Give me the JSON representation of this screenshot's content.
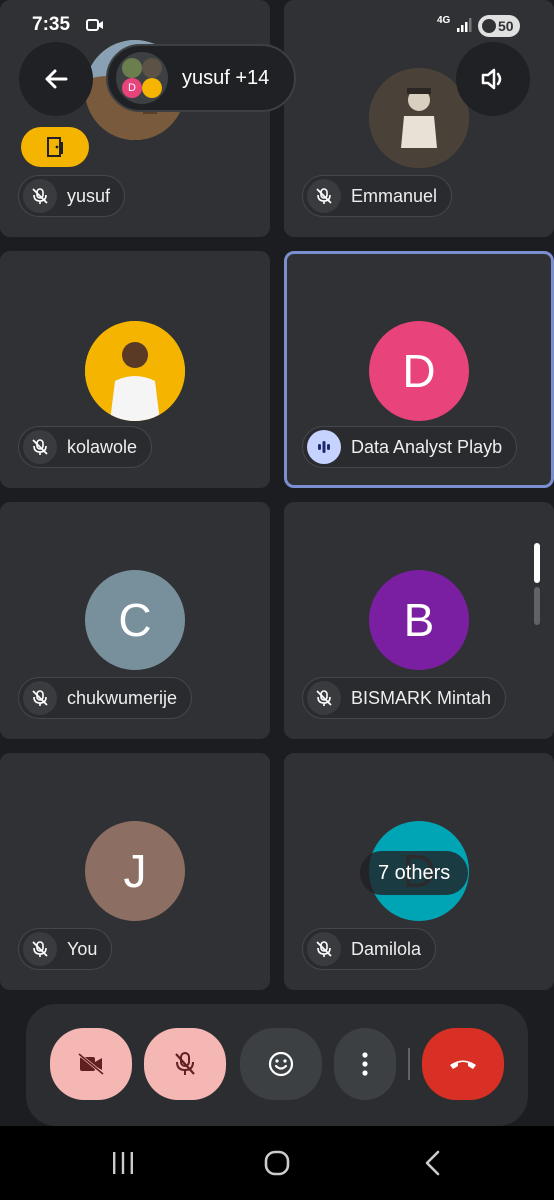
{
  "status": {
    "time": "7:35",
    "network": "4G",
    "battery": "50"
  },
  "header": {
    "participants_label": "yusuf +14"
  },
  "tiles": [
    {
      "name": "yusuf",
      "avatar_letter": "",
      "avatar_color": "#8a7a5a",
      "muted": true
    },
    {
      "name": "Emmanuel",
      "avatar_letter": "",
      "avatar_color": "#6b5e4e",
      "muted": true
    },
    {
      "name": "kolawole",
      "avatar_letter": "",
      "avatar_color": "#f4b400",
      "muted": true
    },
    {
      "name": "Data Analyst Playb",
      "avatar_letter": "D",
      "avatar_color": "#e8437a",
      "muted": false
    },
    {
      "name": "chukwumerije",
      "avatar_letter": "C",
      "avatar_color": "#78909c",
      "muted": true
    },
    {
      "name": "BISMARK Mintah",
      "avatar_letter": "B",
      "avatar_color": "#7b1fa2",
      "muted": true
    },
    {
      "name": "You",
      "avatar_letter": "J",
      "avatar_color": "#8d6e63",
      "muted": true
    },
    {
      "name": "Damilola",
      "avatar_letter": "D",
      "avatar_color": "#00a5b5",
      "muted": true
    }
  ],
  "others_label": "7 others"
}
